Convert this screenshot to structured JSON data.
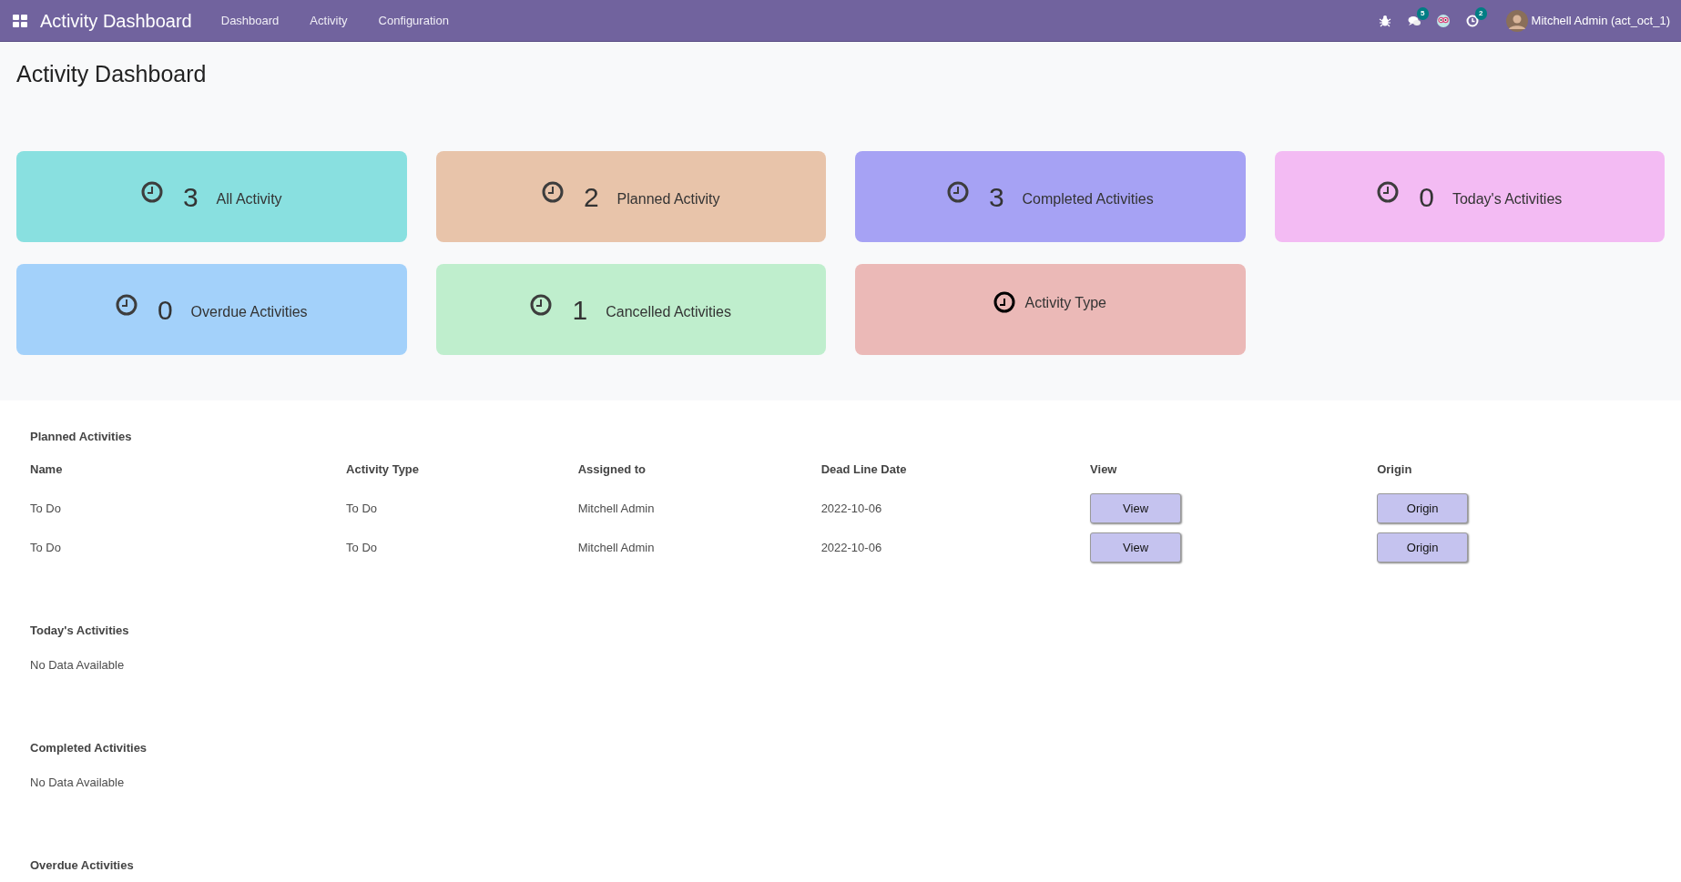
{
  "navbar": {
    "app_title": "Activity Dashboard",
    "menu": [
      "Dashboard",
      "Activity",
      "Configuration"
    ],
    "systray": [
      {
        "kind": "bug"
      },
      {
        "kind": "chat",
        "badge": "5"
      },
      {
        "kind": "owl"
      },
      {
        "kind": "activity",
        "badge": "2"
      }
    ],
    "user": "Mitchell Admin (act_oct_1)"
  },
  "page_title": "Activity Dashboard",
  "cards": [
    {
      "kind": "count",
      "count": "3",
      "label": "All Activity",
      "color": "#89e0e0"
    },
    {
      "kind": "count",
      "count": "2",
      "label": "Planned Activity",
      "color": "#e8c4aa"
    },
    {
      "kind": "count",
      "count": "3",
      "label": "Completed Activities",
      "color": "#a6a2f4"
    },
    {
      "kind": "count",
      "count": "0",
      "label": "Today's Activities",
      "color": "#f3bbf3"
    },
    {
      "kind": "count",
      "count": "0",
      "label": "Overdue Activities",
      "color": "#a3d1fa"
    },
    {
      "kind": "count",
      "count": "1",
      "label": "Cancelled Activities",
      "color": "#bfeecd"
    },
    {
      "kind": "type",
      "label": "Activity Type",
      "color": "#ebb9b7"
    }
  ],
  "sections": [
    {
      "kind": "table",
      "title": "Planned Activities",
      "columns": [
        "Name",
        "Activity Type",
        "Assigned to",
        "Dead Line Date",
        "View",
        "Origin"
      ],
      "rows": [
        {
          "name": "To Do",
          "activity_type": "To Do",
          "assigned_to": "Mitchell Admin",
          "deadline": "2022-10-06",
          "view": "View",
          "origin": "Origin"
        },
        {
          "name": "To Do",
          "activity_type": "To Do",
          "assigned_to": "Mitchell Admin",
          "deadline": "2022-10-06",
          "view": "View",
          "origin": "Origin"
        }
      ]
    },
    {
      "kind": "empty",
      "title": "Today's Activities",
      "empty_text": "No Data Available"
    },
    {
      "kind": "empty",
      "title": "Completed Activities",
      "empty_text": "No Data Available"
    },
    {
      "kind": "heading",
      "title": "Overdue Activities"
    }
  ]
}
